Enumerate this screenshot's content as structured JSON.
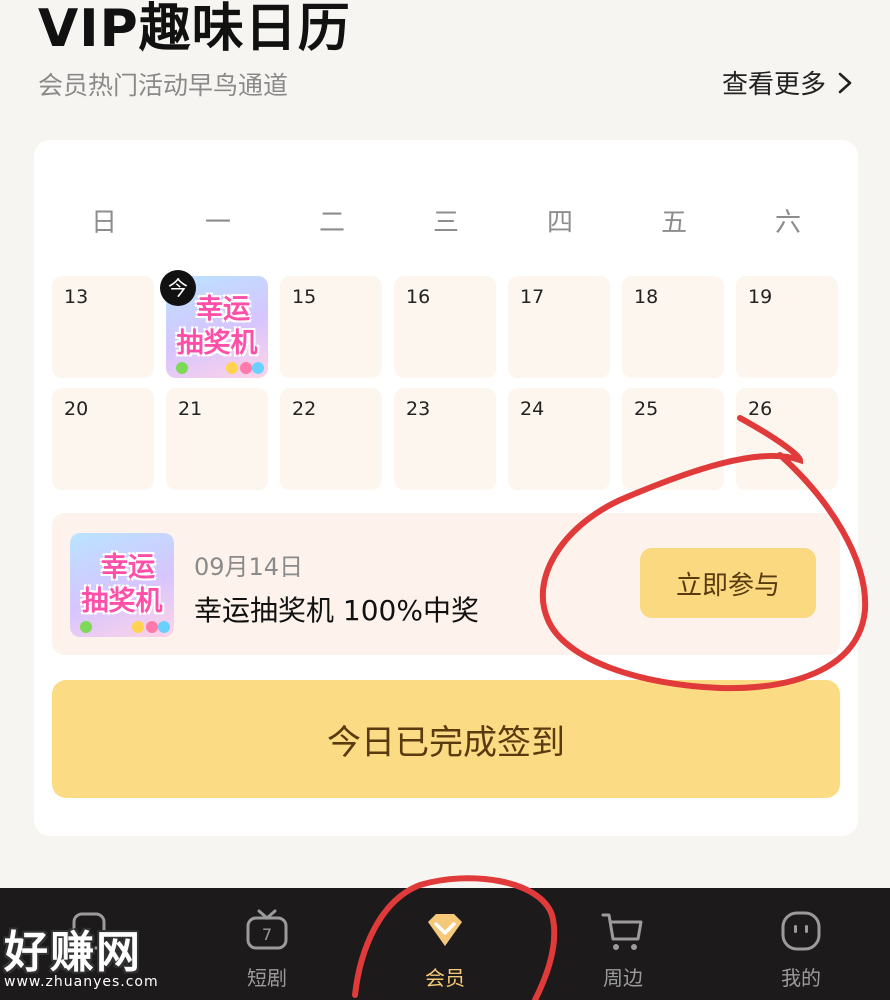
{
  "header": {
    "title": "VIP趣味日历",
    "subtitle": "会员热门活动早鸟通道",
    "more_label": "查看更多"
  },
  "calendar": {
    "weekdays": [
      "日",
      "一",
      "二",
      "三",
      "四",
      "五",
      "六"
    ],
    "row1": [
      "13",
      "",
      "15",
      "16",
      "17",
      "18",
      "19"
    ],
    "row2": [
      "20",
      "21",
      "22",
      "23",
      "24",
      "25",
      "26"
    ],
    "today_badge": "今",
    "special_day_image_text": [
      "幸运",
      "抽奖机"
    ]
  },
  "event": {
    "date": "09月14日",
    "name": "幸运抽奖机 100%中奖",
    "join_label": "立即参与",
    "image_text": [
      "幸运",
      "抽奖机"
    ]
  },
  "checkin_label": "今日已完成签到",
  "tabbar": {
    "items": [
      {
        "label": "",
        "icon": "home-icon"
      },
      {
        "label": "短剧",
        "icon": "tv-icon"
      },
      {
        "label": "会员",
        "icon": "diamond-icon"
      },
      {
        "label": "周边",
        "icon": "cart-icon"
      },
      {
        "label": "我的",
        "icon": "profile-icon"
      }
    ]
  },
  "watermark": {
    "main": "好赚网",
    "url": "www.zhuanyes.com"
  },
  "colors": {
    "background": "#f7f5f1",
    "day_cell": "#fdf6ef",
    "gold_button": "#fbd980",
    "tab_active": "#f5c979",
    "annotation_red": "#e03a3a"
  }
}
